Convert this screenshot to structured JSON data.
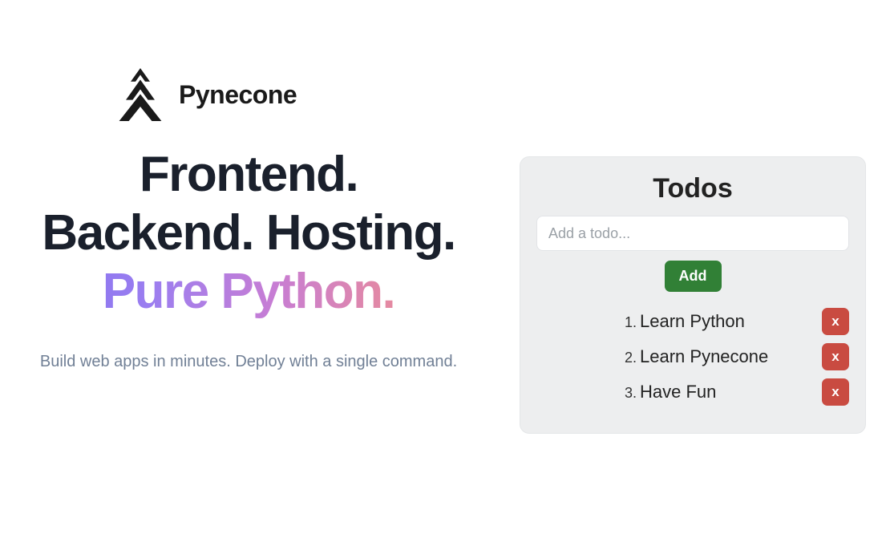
{
  "brand": {
    "name": "Pynecone"
  },
  "hero": {
    "line1": "Frontend.",
    "line2": "Backend. Hosting.",
    "line3": "Pure Python.",
    "subhead": "Build web apps in minutes. Deploy with a single command."
  },
  "todo": {
    "title": "Todos",
    "placeholder": "Add a todo...",
    "add_label": "Add",
    "remove_label": "x",
    "items": [
      {
        "n": "1.",
        "text": "Learn Python"
      },
      {
        "n": "2.",
        "text": "Learn Pynecone"
      },
      {
        "n": "3.",
        "text": "Have Fun"
      }
    ]
  }
}
